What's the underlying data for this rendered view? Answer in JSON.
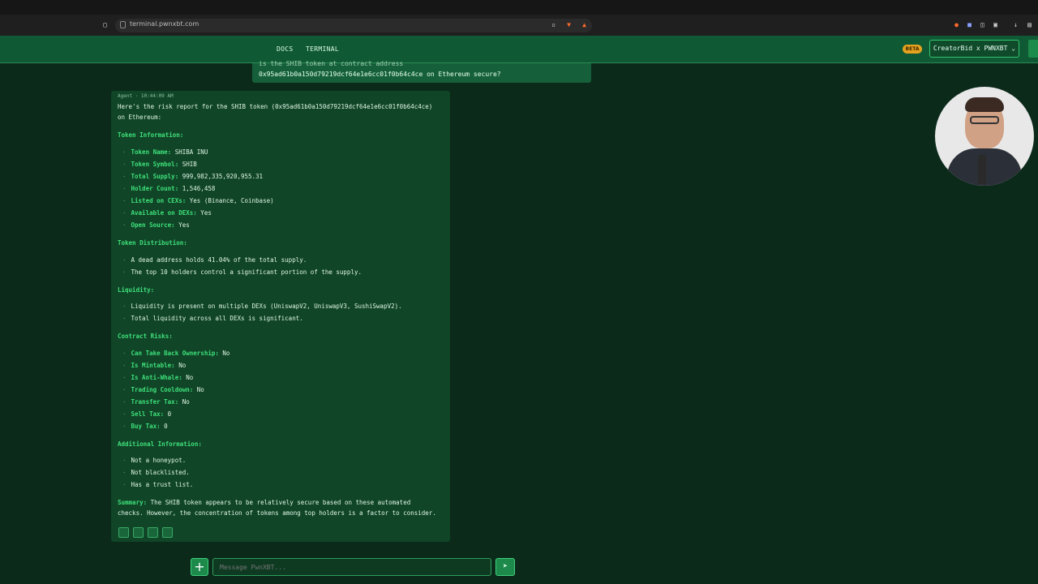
{
  "browser": {
    "url": "terminal.pwnxbt.com"
  },
  "nav": {
    "links": [
      "DOCS",
      "TERMINAL"
    ],
    "beta_badge": "BETA",
    "account_button": "CreatorBid x PWNXBT ⌄"
  },
  "user_message": {
    "line1": "is the SHIB token at contract address",
    "line2": "0x95ad61b0a150d79219dcf64e1e6cc01f0b64c4ce on Ethereum secure?"
  },
  "agent_message": {
    "meta": "Agent · 10:44:09 AM",
    "intro_line1": "Here's the risk report for the SHIB token (0x95ad61b0a150d79219dcf64e1e6cc01f0b64c4ce)",
    "intro_line2": "on Ethereum:",
    "token_information": {
      "heading": "Token Information:",
      "items": [
        {
          "key": "Token Name:",
          "value": " SHIBA INU"
        },
        {
          "key": "Token Symbol:",
          "value": " SHIB"
        },
        {
          "key": "Total Supply:",
          "value": " 999,982,335,920,955.31"
        },
        {
          "key": "Holder Count:",
          "value": " 1,546,458"
        },
        {
          "key": "Listed on CEXs:",
          "value": " Yes (Binance, Coinbase)"
        },
        {
          "key": "Available on DEXs:",
          "value": " Yes"
        },
        {
          "key": "Open Source:",
          "value": " Yes"
        }
      ]
    },
    "token_distribution": {
      "heading": "Token Distribution:",
      "items": [
        "A dead address holds 41.04% of the total supply.",
        "The top 10 holders control a significant portion of the supply."
      ]
    },
    "liquidity": {
      "heading": "Liquidity:",
      "items": [
        "Liquidity is present on multiple DEXs (UniswapV2, UniswapV3, SushiSwapV2).",
        "Total liquidity across all DEXs is significant."
      ]
    },
    "contract_risks": {
      "heading": "Contract Risks:",
      "items": [
        {
          "key": "Can Take Back Ownership:",
          "value": " No"
        },
        {
          "key": "Is Mintable:",
          "value": " No"
        },
        {
          "key": "Is Anti-Whale:",
          "value": " No"
        },
        {
          "key": "Trading Cooldown:",
          "value": " No"
        },
        {
          "key": "Transfer Tax:",
          "value": " No"
        },
        {
          "key": "Sell Tax:",
          "value": " 0"
        },
        {
          "key": "Buy Tax:",
          "value": " 0"
        }
      ]
    },
    "additional_information": {
      "heading": "Additional Information:",
      "items": [
        "Not a honeypot.",
        "Not blacklisted.",
        "Has a trust list."
      ]
    },
    "summary_key": "Summary:",
    "summary_line1": " The SHIB token appears to be relatively secure based on these automated",
    "summary_line2": "checks. However, the concentration of tokens among top holders is a factor to consider."
  },
  "composer": {
    "plus": "+",
    "placeholder": "Message PwnXBT...",
    "send": "➤"
  },
  "colors": {
    "background": "#0b2a1a",
    "navbar": "#0f5a34",
    "accent": "#3ee07a",
    "card": "#104527"
  }
}
